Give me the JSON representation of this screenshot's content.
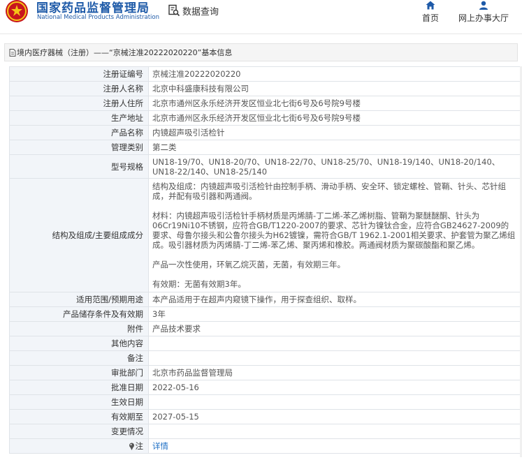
{
  "header": {
    "site_title": "国家药品监督管理局",
    "site_subtitle": "National Medical Products Administration",
    "data_query": "数据查询",
    "nav": [
      {
        "label": "首页",
        "icon": "home-icon"
      },
      {
        "label": "网上办事大厅",
        "icon": "user-icon"
      }
    ],
    "brand_color": "#1e5aa8"
  },
  "breadcrumb": {
    "text": "境内医疗器械（注册）——“京械注准20222020220”基本信息"
  },
  "rows": [
    {
      "label": "注册证编号",
      "value": "京械注准20222020220"
    },
    {
      "label": "注册人名称",
      "value": "北京中科盛康科技有限公司"
    },
    {
      "label": "注册人住所",
      "value": "北京市通州区永乐经济开发区恒业北七街6号及6号院9号楼"
    },
    {
      "label": "生产地址",
      "value": "北京市通州区永乐经济开发区恒业北七街6号及6号院9号楼"
    },
    {
      "label": "产品名称",
      "value": "内镜超声吸引活检针"
    },
    {
      "label": "管理类别",
      "value": "第二类"
    },
    {
      "label": "型号规格",
      "value": "UN18-19/70、UN18-20/70、UN18-22/70、UN18-25/70、UN18-19/140、UN18-20/140、UN18-22/140、UN18-25/140"
    },
    {
      "label": "结构及组成/主要组成成分",
      "paragraphs": [
        "结构及组成：内镜超声吸引活检针由控制手柄、滑动手柄、安全环、锁定螺栓、管鞘、针头、芯针组成，并配有吸引器和两通阀。",
        "材料：内镜超声吸引活检针手柄材质是丙烯腈-丁二烯-苯乙烯树脂、管鞘为聚醚醚酮、针头为06Cr19Ni10不锈钢，应符合GB/T1220-2007的要求、芯针为镍钛合金，应符合GB24627-2009的要求、母鲁尔接头和公鲁尔接头为H62镀镍，需符合GB/T 1962.1-2001相关要求、护套管为聚乙烯组成。吸引器材质为丙烯腈-丁二烯-苯乙烯、聚丙烯和橡胶。两通阀材质为聚碳酸酯和聚乙烯。",
        "产品一次性使用，环氧乙烷灭菌，无菌，有效期三年。",
        "有效期：无菌有效期3年。"
      ]
    },
    {
      "label": "适用范围/预期用途",
      "value": "本产品适用于在超声内窥镜下操作，用于探查组织、取样。"
    },
    {
      "label": "产品储存条件及有效期",
      "value": "3年"
    },
    {
      "label": "附件",
      "value": "产品技术要求"
    },
    {
      "label": "其他内容",
      "value": ""
    },
    {
      "label": "备注",
      "value": ""
    },
    {
      "label": "审批部门",
      "value": "北京市药品监督管理局"
    },
    {
      "label": "批准日期",
      "value": "2022-05-16"
    },
    {
      "label": "生效日期",
      "value": ""
    },
    {
      "label": "有效期至",
      "value": "2027-05-15"
    },
    {
      "label": "变更情况",
      "value": ""
    },
    {
      "label": "注",
      "value": "详情",
      "icon": "pin-icon",
      "link_color": "#1e6fc5"
    }
  ]
}
